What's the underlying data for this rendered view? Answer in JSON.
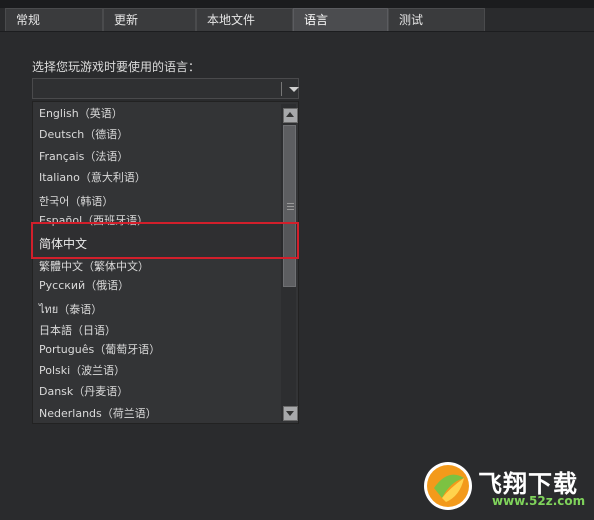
{
  "tabs": [
    {
      "label": "常规",
      "active": false
    },
    {
      "label": "更新",
      "active": false
    },
    {
      "label": "本地文件",
      "active": false
    },
    {
      "label": "语言",
      "active": true
    },
    {
      "label": "测试",
      "active": false
    }
  ],
  "language_prompt": "选择您玩游戏时要使用的语言：",
  "selected_value": "",
  "languages": [
    "English（英语）",
    "Deutsch（德语）",
    "Français（法语）",
    "Italiano（意大利语）",
    "한국어（韩语）",
    "Español（西班牙语）",
    "简体中文",
    "繁體中文（繁体中文）",
    "Русский（俄语）",
    "ไทย（泰语）",
    "日本語（日语）",
    "Português（葡萄牙语）",
    "Polski（波兰语）",
    "Dansk（丹麦语）",
    "Nederlands（荷兰语）"
  ],
  "highlighted_language": "简体中文",
  "watermark": {
    "text": "飞翔下载",
    "url": "www.52z.com"
  },
  "colors": {
    "highlight_border": "#d21f2b",
    "background": "#2a2b2d"
  }
}
